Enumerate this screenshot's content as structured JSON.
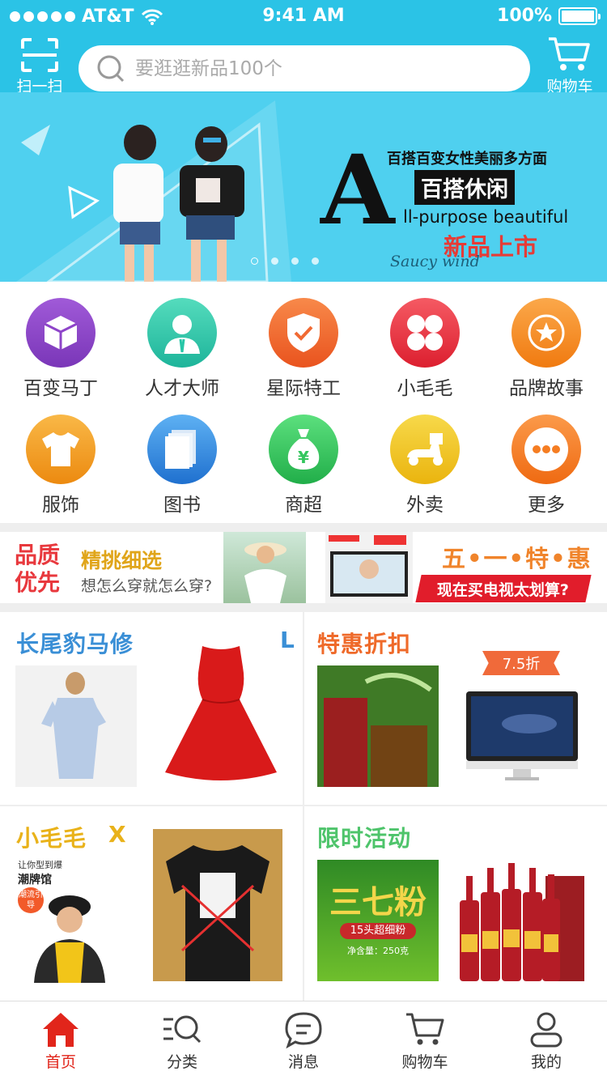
{
  "status_bar": {
    "carrier": "AT&T",
    "time": "9:41 AM",
    "battery": "100%"
  },
  "header": {
    "scan_label": "扫一扫",
    "search_placeholder": "要逛逛新品100个",
    "cart_label": "购物车"
  },
  "banner": {
    "line1": "百搭百变女性美丽多方面",
    "tag": "百搭休闲",
    "big_letter": "A",
    "line3": "ll-purpose beautiful",
    "line4": "新品上市",
    "script": "Saucy wind",
    "pages": 4,
    "active_page": 1
  },
  "grid": [
    {
      "label": "百变马丁",
      "icon": "cube-icon",
      "color": "#8e44c9"
    },
    {
      "label": "人才大师",
      "icon": "person-icon",
      "color": "#26c6a7"
    },
    {
      "label": "星际特工",
      "icon": "shield-icon",
      "color": "#f16a33"
    },
    {
      "label": "小毛毛",
      "icon": "clover-icon",
      "color": "#ea3441"
    },
    {
      "label": "品牌故事",
      "icon": "medal-icon",
      "color": "#f58a1f"
    },
    {
      "label": "服饰",
      "icon": "tshirt-icon",
      "color": "#f3a024"
    },
    {
      "label": "图书",
      "icon": "book-icon",
      "color": "#2f86dd"
    },
    {
      "label": "商超",
      "icon": "money-bag-icon",
      "color": "#33c65d"
    },
    {
      "label": "外卖",
      "icon": "scooter-icon",
      "color": "#f1c21c"
    },
    {
      "label": "更多",
      "icon": "more-icon",
      "color": "#f57d22"
    }
  ],
  "promo": {
    "quality": "品质",
    "first": "优先",
    "pick": "精挑细选",
    "sub": "想怎么穿就怎么穿?",
    "may_sale": "五•一•特•惠",
    "tv": "现在买电视太划算?"
  },
  "panels": {
    "p1": {
      "title": "长尾豹马修",
      "letter": "L",
      "color": "#3a8fd6"
    },
    "p2": {
      "title": "特惠折扣",
      "discount": "7.5折",
      "color": "#ef6a2a"
    },
    "p3": {
      "title": "小毛毛",
      "letter": "X",
      "color": "#e9b21a",
      "small1": "让你型到爆",
      "small2": "潮牌馆",
      "badge": "潮流引导"
    },
    "p4": {
      "title": "限时活动",
      "color": "#4ec46b",
      "powder": "三七粉",
      "spec": "15头超细粉",
      "weight": "净含量：250克"
    }
  },
  "tabs": [
    {
      "label": "首页",
      "icon": "home-icon"
    },
    {
      "label": "分类",
      "icon": "category-search-icon"
    },
    {
      "label": "消息",
      "icon": "message-icon"
    },
    {
      "label": "购物车",
      "icon": "cart-icon"
    },
    {
      "label": "我的",
      "icon": "user-icon"
    }
  ]
}
